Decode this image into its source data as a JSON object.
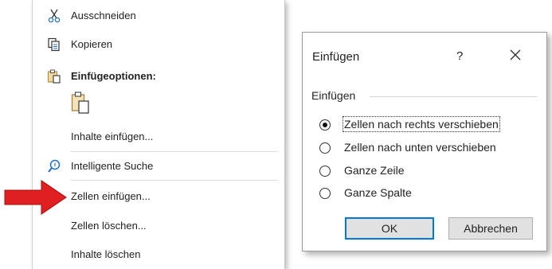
{
  "context_menu": {
    "items": [
      {
        "label": "Ausschneiden",
        "icon": "scissors-icon"
      },
      {
        "label": "Kopieren",
        "icon": "copy-icon"
      },
      {
        "label": "Einfügeoptionen:",
        "icon": "clipboard-icon"
      },
      {
        "label": "Inhalte einfügen..."
      },
      {
        "label": "Intelligente Suche",
        "icon": "search-icon"
      },
      {
        "label": "Zellen einfügen..."
      },
      {
        "label": "Zellen löschen..."
      },
      {
        "label": "Inhalte löschen"
      }
    ],
    "paste_option_icon": "paste-clipboard-icon"
  },
  "pointer_arrow": {
    "color": "#e02020"
  },
  "dialog": {
    "title": "Einfügen",
    "help": "?",
    "group_label": "Einfügen",
    "options": [
      {
        "label": "Zellen nach rechts verschieben",
        "selected": true
      },
      {
        "label": "Zellen nach unten verschieben",
        "selected": false
      },
      {
        "label": "Ganze Zeile",
        "selected": false
      },
      {
        "label": "Ganze Spalte",
        "selected": false
      }
    ],
    "ok_label": "OK",
    "cancel_label": "Abbrechen",
    "accent_color": "#0078d7"
  }
}
